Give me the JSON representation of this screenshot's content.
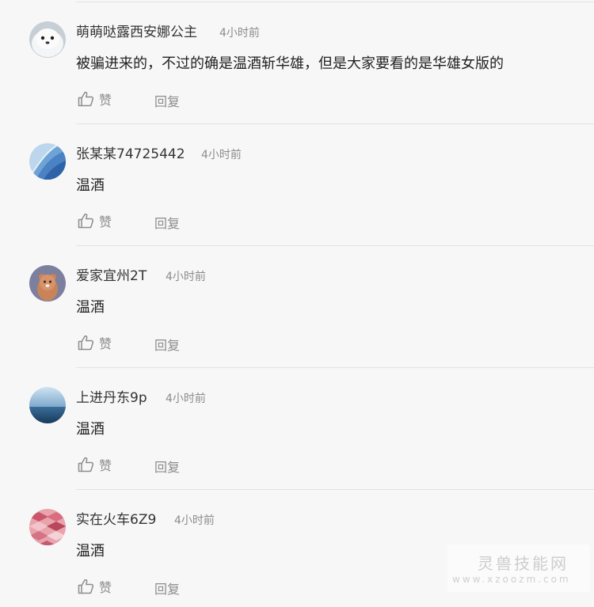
{
  "comments": [
    {
      "username": "萌萌哒露西安娜公主",
      "time": "4小时前",
      "content": "被骗进来的，不过的确是温酒斩华雄，但是大家要看的是华雄女版的",
      "like_label": "赞",
      "reply_label": "回复",
      "avatar_icon": "seal-avatar-icon"
    },
    {
      "username": "张某某74725442",
      "time": "4小时前",
      "content": "温酒",
      "like_label": "赞",
      "reply_label": "回复",
      "avatar_icon": "blue-wave-avatar-icon"
    },
    {
      "username": "爱家宜州2T",
      "time": "4小时前",
      "content": "温酒",
      "like_label": "赞",
      "reply_label": "回复",
      "avatar_icon": "bear-avatar-icon"
    },
    {
      "username": "上进丹东9p",
      "time": "4小时前",
      "content": "温酒",
      "like_label": "赞",
      "reply_label": "回复",
      "avatar_icon": "ocean-avatar-icon"
    },
    {
      "username": "实在火车6Z9",
      "time": "4小时前",
      "content": "温酒",
      "like_label": "赞",
      "reply_label": "回复",
      "avatar_icon": "pink-pattern-avatar-icon"
    }
  ],
  "watermark": {
    "line1": "灵兽技能网",
    "line2": "www.xzoozm.com"
  }
}
